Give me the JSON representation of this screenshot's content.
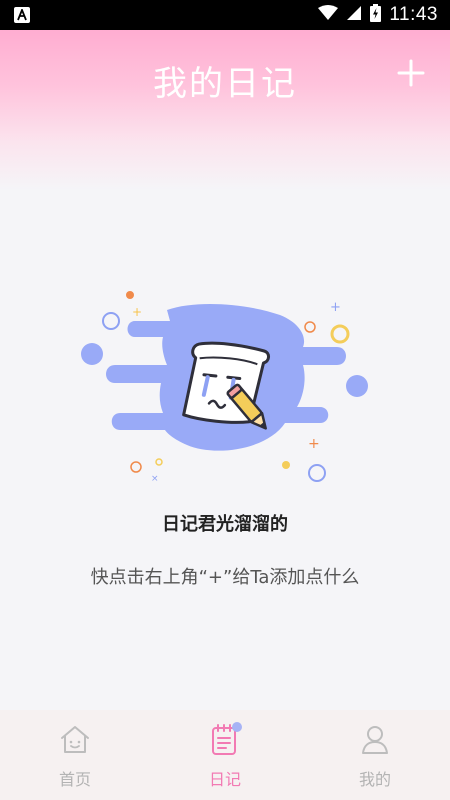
{
  "status_bar": {
    "time": "11:43",
    "icons": [
      "app-icon",
      "wifi-icon",
      "signal-icon",
      "battery-charging-icon"
    ]
  },
  "header": {
    "title": "我的日记",
    "add_icon": "plus-icon"
  },
  "empty_state": {
    "illustration": "sad-notebook-pencil-icon",
    "title": "日记君光溜溜的",
    "hint": "快点击右上角“+”给Ta添加点什么"
  },
  "tab_bar": {
    "tabs": [
      {
        "label": "首页",
        "icon": "home-icon",
        "active": false
      },
      {
        "label": "日记",
        "icon": "diary-icon",
        "active": true
      },
      {
        "label": "我的",
        "icon": "profile-icon",
        "active": false
      }
    ]
  },
  "colors": {
    "header_pink": "#ffadd1",
    "active_tab": "#f27ab3",
    "inactive_tab": "#b3b3b3",
    "blob_blue": "#99aaf7"
  }
}
